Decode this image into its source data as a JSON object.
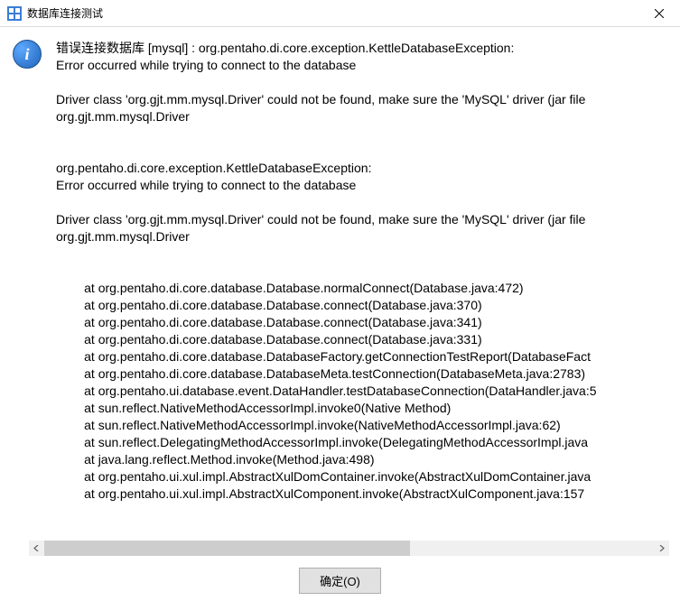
{
  "titlebar": {
    "title": "数据库连接测试"
  },
  "message": {
    "line1": "错误连接数据库 [mysql] : org.pentaho.di.core.exception.KettleDatabaseException:",
    "line2": "Error occurred while trying to connect to the database",
    "line3": "",
    "line4": "Driver class 'org.gjt.mm.mysql.Driver' could not be found, make sure the 'MySQL' driver (jar file",
    "line5": "org.gjt.mm.mysql.Driver",
    "line6": "",
    "line7": "",
    "line8": "org.pentaho.di.core.exception.KettleDatabaseException:",
    "line9": "Error occurred while trying to connect to the database",
    "line10": "",
    "line11": "Driver class 'org.gjt.mm.mysql.Driver' could not be found, make sure the 'MySQL' driver (jar file",
    "line12": "org.gjt.mm.mysql.Driver",
    "line13": "",
    "line14": "",
    "trace1": "\tat org.pentaho.di.core.database.Database.normalConnect(Database.java:472)",
    "trace2": "\tat org.pentaho.di.core.database.Database.connect(Database.java:370)",
    "trace3": "\tat org.pentaho.di.core.database.Database.connect(Database.java:341)",
    "trace4": "\tat org.pentaho.di.core.database.Database.connect(Database.java:331)",
    "trace5": "\tat org.pentaho.di.core.database.DatabaseFactory.getConnectionTestReport(DatabaseFact",
    "trace6": "\tat org.pentaho.di.core.database.DatabaseMeta.testConnection(DatabaseMeta.java:2783)",
    "trace7": "\tat org.pentaho.ui.database.event.DataHandler.testDatabaseConnection(DataHandler.java:5",
    "trace8": "\tat sun.reflect.NativeMethodAccessorImpl.invoke0(Native Method)",
    "trace9": "\tat sun.reflect.NativeMethodAccessorImpl.invoke(NativeMethodAccessorImpl.java:62)",
    "trace10": "\tat sun.reflect.DelegatingMethodAccessorImpl.invoke(DelegatingMethodAccessorImpl.java",
    "trace11": "\tat java.lang.reflect.Method.invoke(Method.java:498)",
    "trace12": "\tat org.pentaho.ui.xul.impl.AbstractXulDomContainer.invoke(AbstractXulDomContainer.java",
    "trace13": "\tat org.pentaho.ui.xul.impl.AbstractXulComponent.invoke(AbstractXulComponent.java:157"
  },
  "buttons": {
    "ok_label": "确定(O)"
  }
}
